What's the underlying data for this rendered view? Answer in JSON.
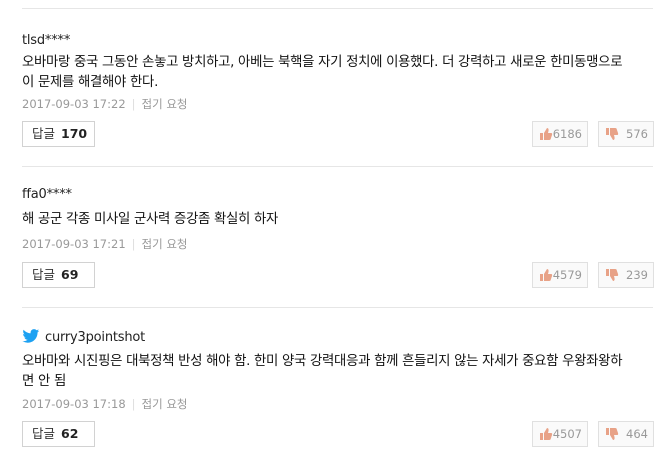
{
  "comments": [
    {
      "author": "tlsd****",
      "text": "오바마랑 중국 그동안 손놓고 방치하고, 아베는 북핵을 자기 정치에 이용했다. 더 강력하고 새로운 한미동맹으로 이 문제를 해결해야 한다.",
      "date": "2017-09-03 17:22",
      "report": "접기 요청",
      "reply_label": "답글",
      "reply_count": "170",
      "likes": "6186",
      "dislikes": "576"
    },
    {
      "author": "ffa0****",
      "text": "해 공군 각종 미사일 군사력 증강좀 확실히 하자",
      "date": "2017-09-03 17:21",
      "report": "접기 요청",
      "reply_label": "답글",
      "reply_count": "69",
      "likes": "4579",
      "dislikes": "239"
    },
    {
      "author": "curry3pointshot",
      "text": "오바마와 시진핑은 대북정책 반성 해야 함. 한미 양국 강력대응과 함께 흔들리지 않는 자세가 중요함 우왕좌왕하면 안 됨",
      "date": "2017-09-03 17:18",
      "report": "접기 요청",
      "reply_label": "답글",
      "reply_count": "62",
      "likes": "4507",
      "dislikes": "464"
    }
  ],
  "colors": {
    "like_icon": "#e8a287",
    "dislike_icon": "#e8a287",
    "twitter": "#1da1f2"
  },
  "icons": {
    "like": "thumbs-up-icon",
    "dislike": "thumbs-down-icon",
    "twitter": "twitter-bird-icon"
  }
}
